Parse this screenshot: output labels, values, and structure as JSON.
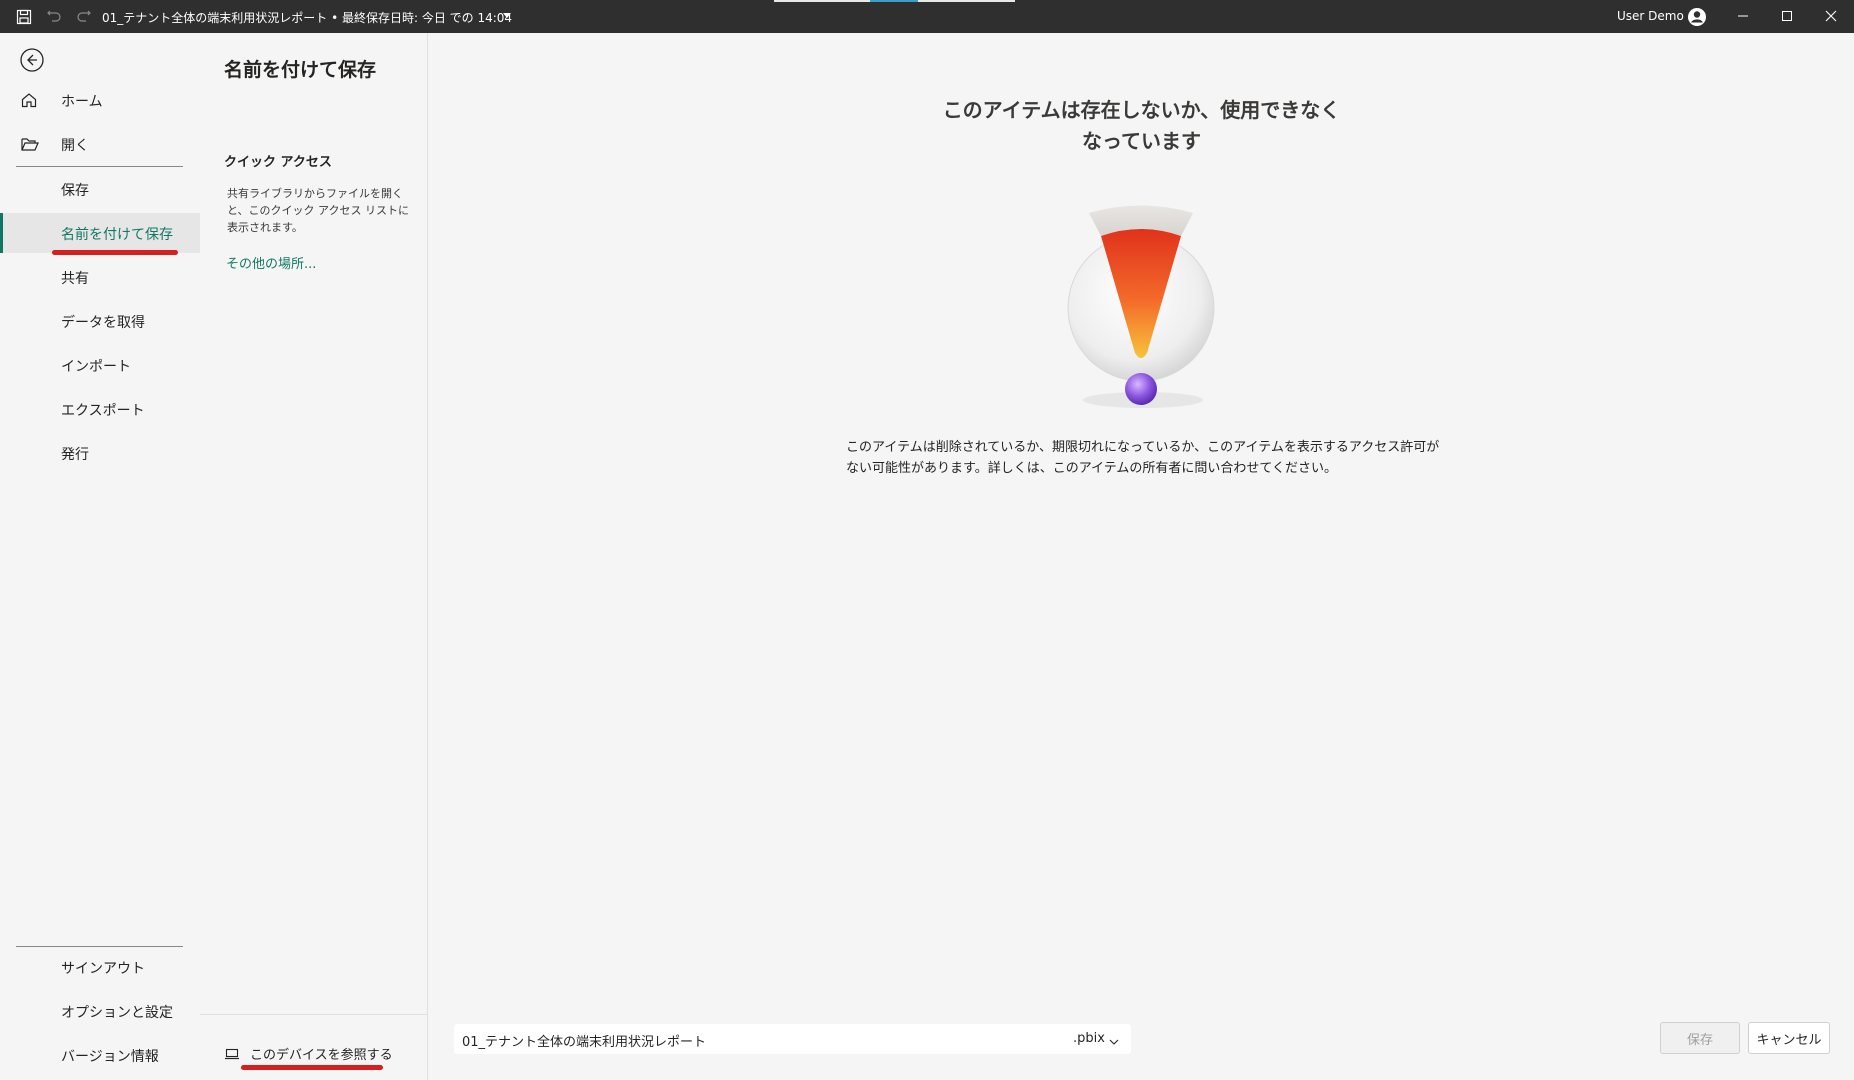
{
  "titlebar": {
    "document_title": "01_テナント全体の端末利用状況レポート • 最終保存日時: 今日 での 14:04",
    "user_name": "User Demo"
  },
  "nav": {
    "items": [
      {
        "label": "ホーム",
        "icon": "home-icon"
      },
      {
        "label": "開く",
        "icon": "folder-open-icon"
      },
      {
        "label": "保存"
      },
      {
        "label": "名前を付けて保存",
        "active": true
      },
      {
        "label": "共有"
      },
      {
        "label": "データを取得"
      },
      {
        "label": "インポート"
      },
      {
        "label": "エクスポート"
      },
      {
        "label": "発行"
      }
    ],
    "bottom_items": [
      {
        "label": "サインアウト"
      },
      {
        "label": "オプションと設定"
      },
      {
        "label": "バージョン情報"
      }
    ]
  },
  "quick_access": {
    "page_title": "名前を付けて保存",
    "heading": "クイック アクセス",
    "description": "共有ライブラリからファイルを開くと、このクイック アクセス リストに表示されます。",
    "other_locations_link": "その他の場所...",
    "browse_device": "このデバイスを参照する"
  },
  "main": {
    "error_title": "このアイテムは存在しないか、使用できなくなっています",
    "error_body": "このアイテムは削除されているか、期限切れになっているか、このアイテムを表示するアクセス許可がない可能性があります。詳しくは、このアイテムの所有者に問い合わせてください。"
  },
  "save_bar": {
    "file_name": "01_テナント全体の端末利用状況レポート",
    "file_extension": ".pbix",
    "save_label": "保存",
    "cancel_label": "キャンセル"
  },
  "colors": {
    "accent": "#117865",
    "titlebar": "#2f2f2f",
    "annotation_red": "#d61f1f"
  }
}
